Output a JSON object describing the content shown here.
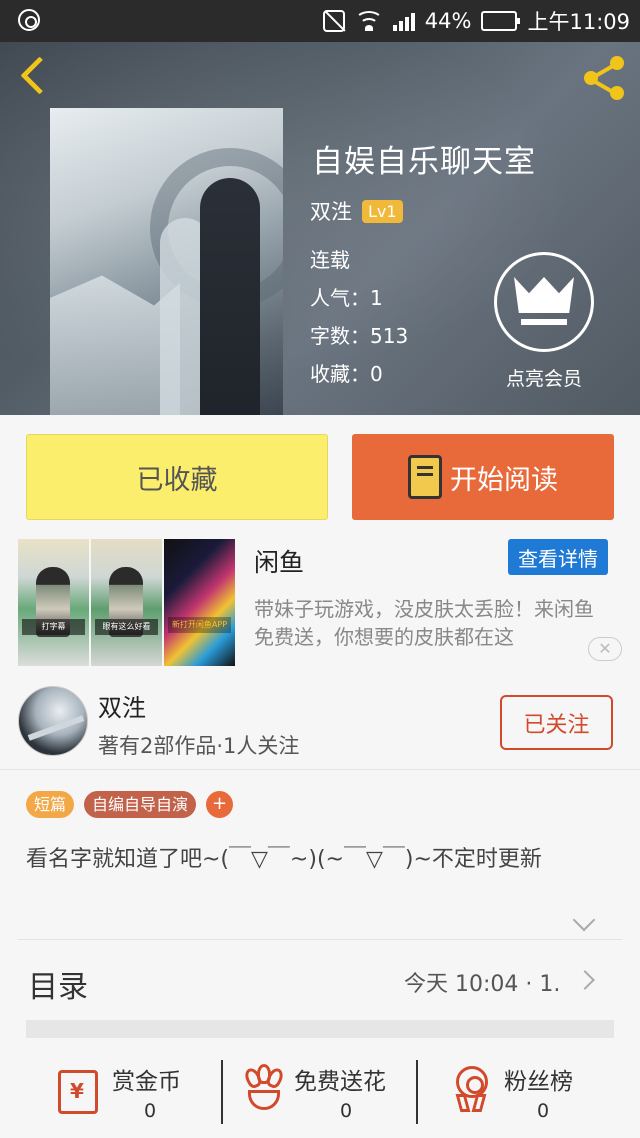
{
  "status_bar": {
    "battery": "44%",
    "time": "上午11:09"
  },
  "book": {
    "title": "自娱自乐聊天室",
    "author": "双泩",
    "level": "Lv1",
    "status": "连载",
    "popularity": "人气：1",
    "word_count": "字数：513",
    "favorites": "收藏：0",
    "vip_label": "点亮会员"
  },
  "actions": {
    "collect_label": "已收藏",
    "read_label": "开始阅读"
  },
  "ad": {
    "name": "闲鱼",
    "detail_label": "查看详情",
    "description": "带妹子玩游戏，没皮肤太丢脸！来闲鱼免费送，你想要的皮肤都在这",
    "close_label": "✕",
    "thumb_captions": [
      "打字幕",
      "眼有这么好看",
      "新打开闲鱼APP"
    ]
  },
  "author_card": {
    "name": "双泩",
    "stats": "著有2部作品·1人关注",
    "follow_label": "已关注"
  },
  "tags": [
    {
      "label": "短篇"
    },
    {
      "label": "自编自导自演"
    },
    {
      "label": "+"
    }
  ],
  "synopsis": "看名字就知道了吧~(￣▽￣~)(~￣▽￣)~不定时更新",
  "toc": {
    "title": "目录",
    "latest": "今天 10:04 · 1."
  },
  "bottom_bar": [
    {
      "label": "赏金币",
      "count": "0"
    },
    {
      "label": "免费送花",
      "count": "0"
    },
    {
      "label": "粉丝榜",
      "count": "0"
    }
  ],
  "colors": {
    "accent_yellow": "#f0c419",
    "collect_bg": "#fbee6d",
    "read_bg": "#e86a3a",
    "follow_red": "#d24a2b",
    "ad_button_blue": "#1f7ad6"
  }
}
